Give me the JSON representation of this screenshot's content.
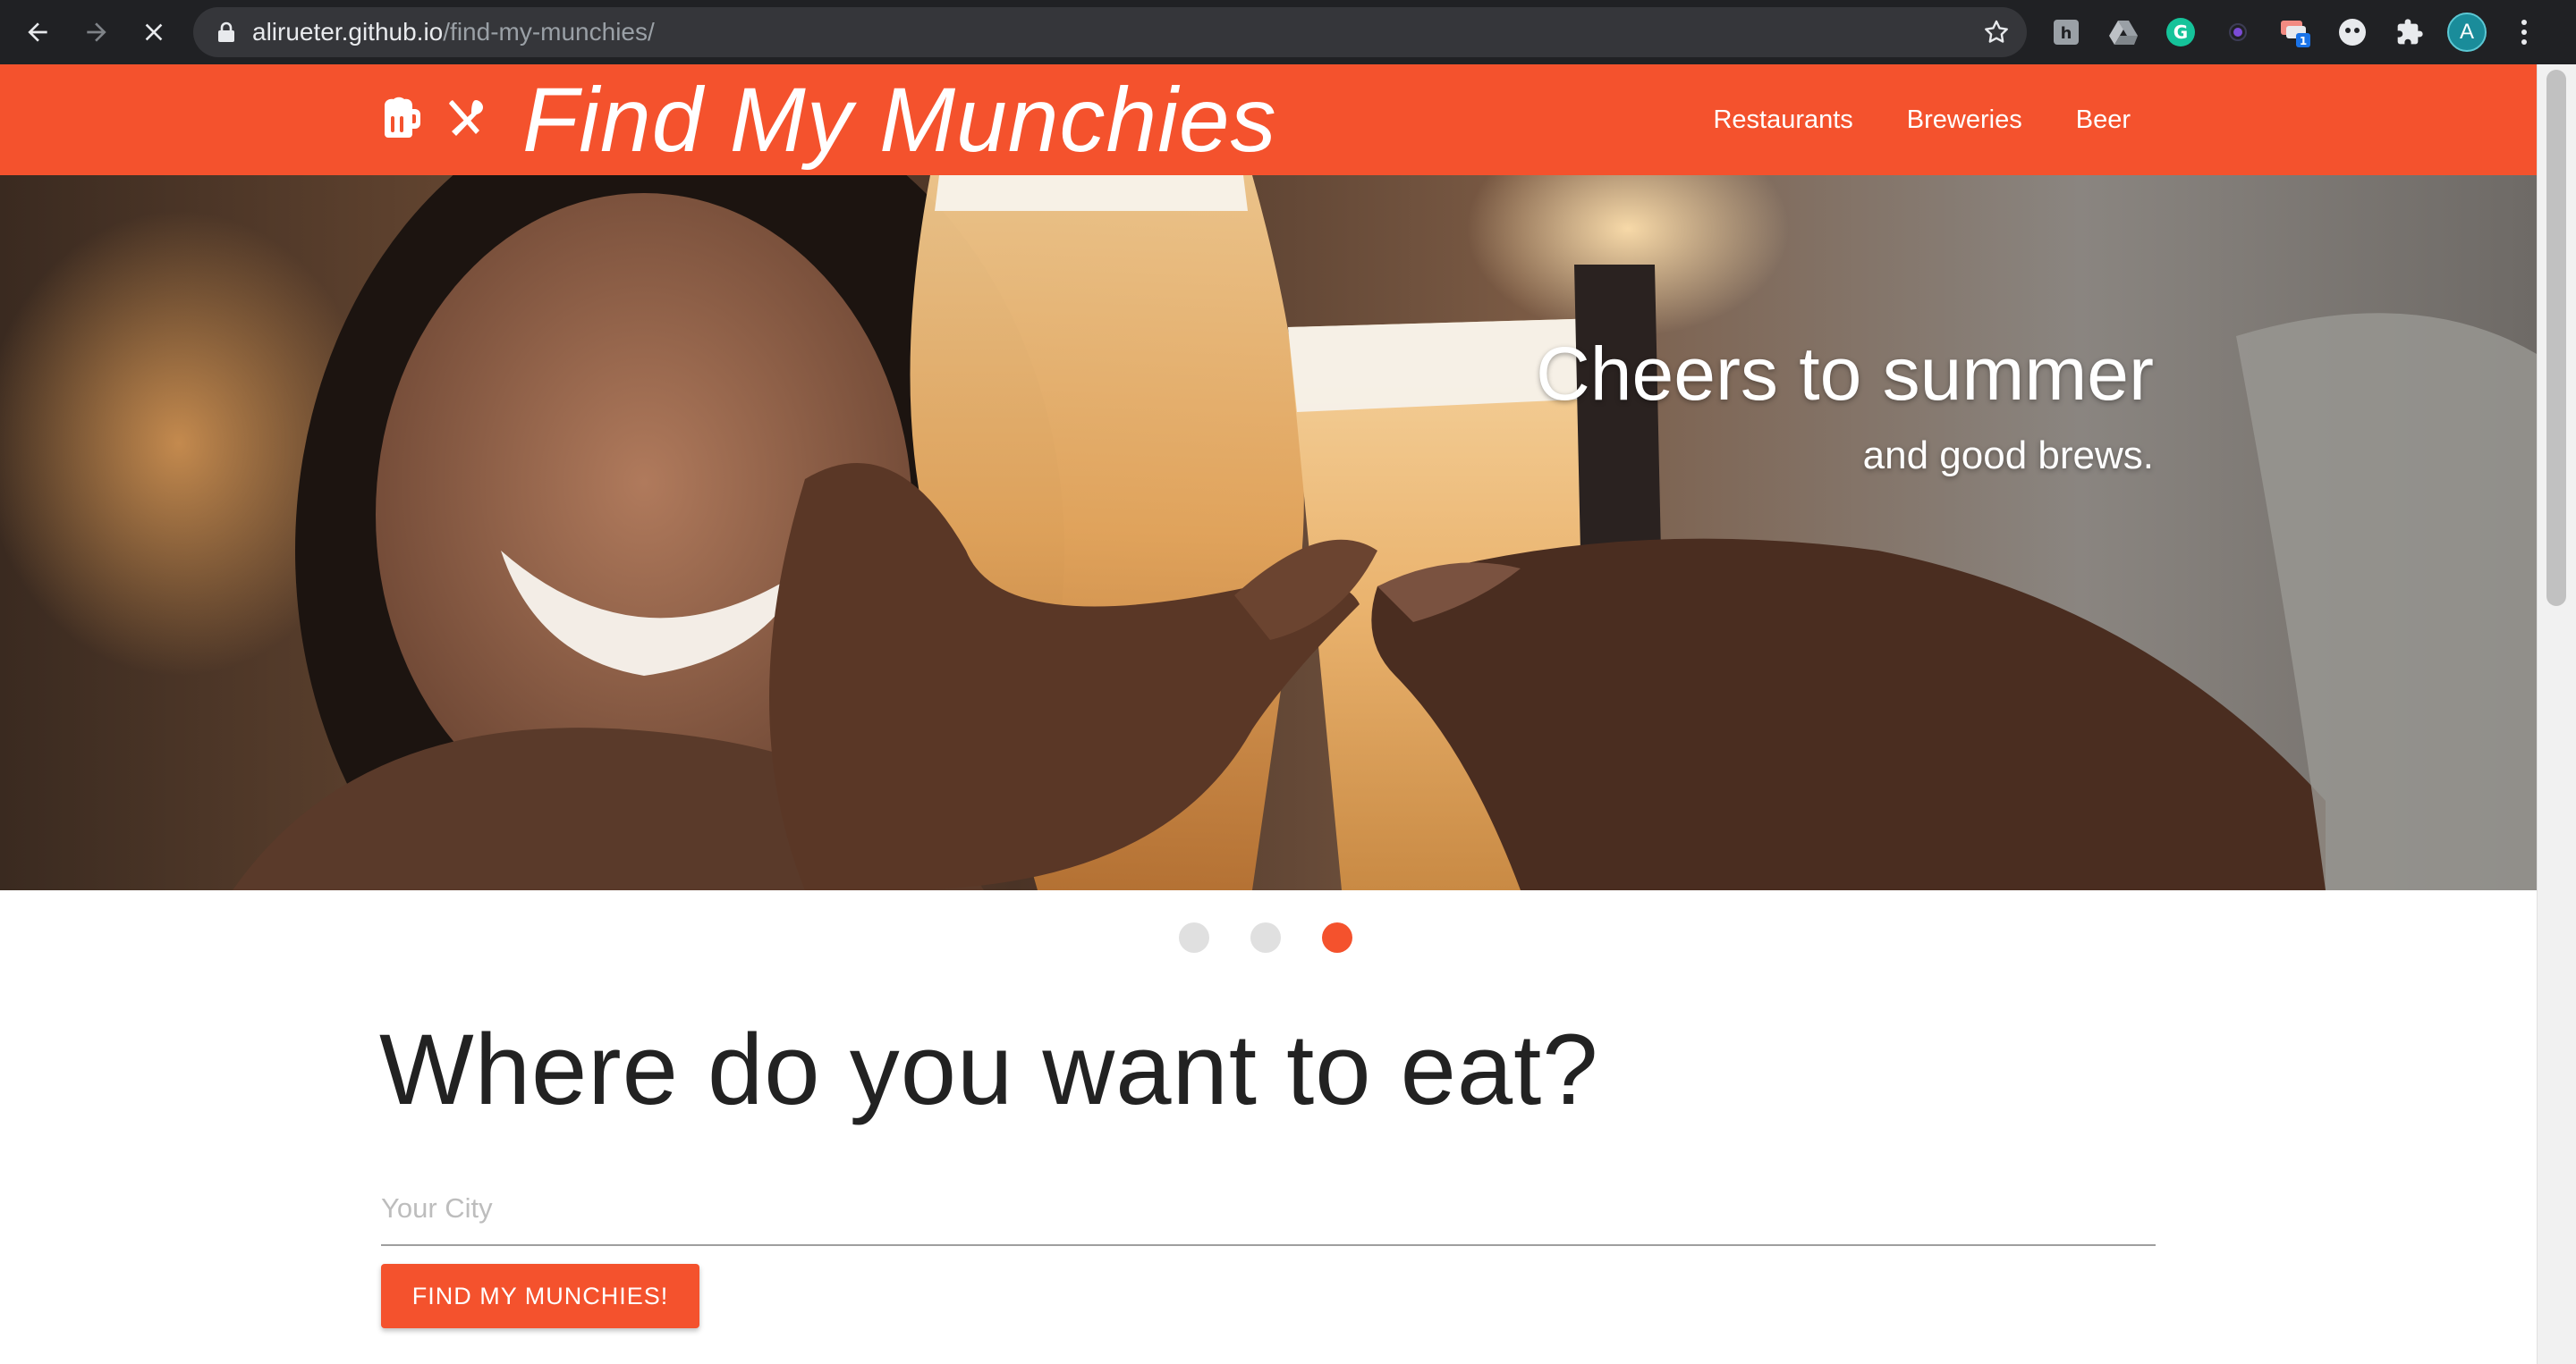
{
  "browser": {
    "url_host": "alirueter.github.io",
    "url_path": "/find-my-munchies/",
    "extension_badge": "1",
    "profile_initial": "A",
    "icons": [
      "back-icon",
      "forward-icon",
      "stop-icon",
      "lock-icon",
      "star-icon",
      "extensions-icon",
      "menu-icon"
    ]
  },
  "navbar": {
    "brand": "Find My Munchies",
    "links": [
      {
        "label": "Restaurants"
      },
      {
        "label": "Breweries"
      },
      {
        "label": "Beer"
      }
    ]
  },
  "hero": {
    "title": "Cheers to summer",
    "subtitle": "and good brews.",
    "slide_count": 3,
    "active_slide": 3
  },
  "search": {
    "heading": "Where do you want to eat?",
    "city_placeholder": "Your City",
    "city_value": "",
    "button_label": "FIND MY MUNCHIES!"
  },
  "colors": {
    "brand": "#f4522d",
    "dot_inactive": "#e0e0e0",
    "heading_text": "#222222",
    "toolbar": "#202124"
  }
}
